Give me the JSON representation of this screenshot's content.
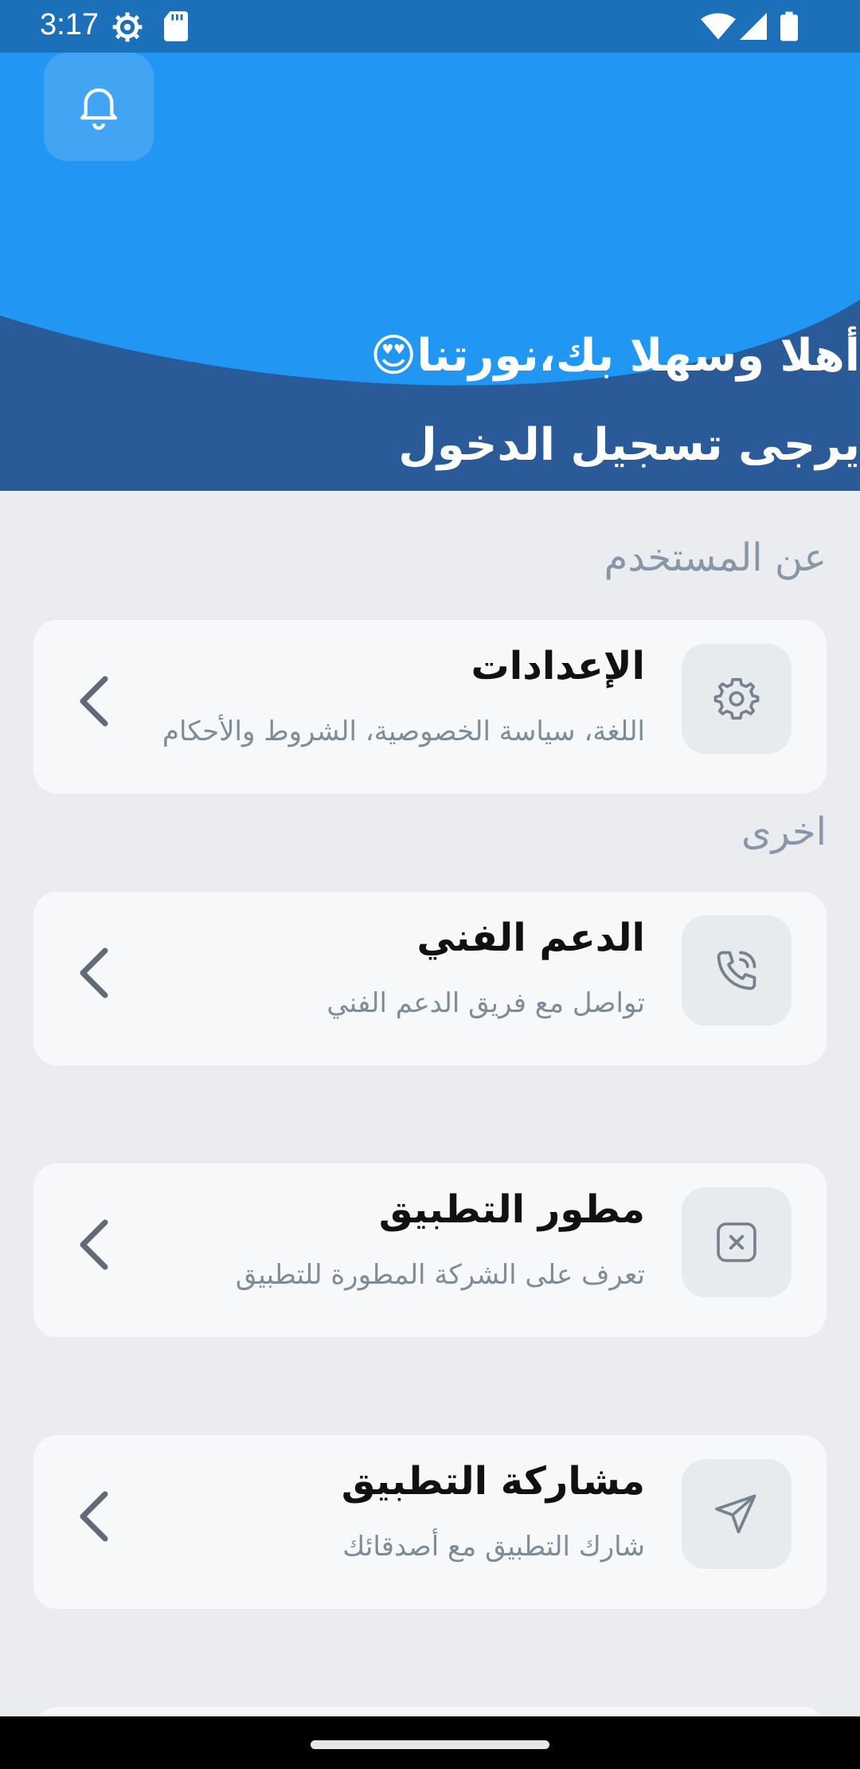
{
  "status_bar": {
    "time": "3:17",
    "icons": [
      "settings-gear-icon",
      "sd-card-icon",
      "wifi-icon",
      "signal-icon",
      "battery-icon"
    ]
  },
  "header": {
    "greeting": "أهلا وسهلا بك،نورتنا😍",
    "login_prompt": "يرجى تسجيل الدخول",
    "bell_icon": "bell-icon",
    "colors": {
      "top": "#2196f3",
      "bottom": "#2a5b98"
    }
  },
  "sections": {
    "user": {
      "title": "عن المستخدم"
    },
    "other": {
      "title": "اخرى"
    }
  },
  "cards": [
    {
      "title": "الإعدادات",
      "subtitle": "اللغة، سياسة الخصوصية، الشروط والأحكام",
      "icon": "gear-icon"
    },
    {
      "title": "الدعم الفني",
      "subtitle": "تواصل مع فريق الدعم الفني",
      "icon": "phone-icon"
    },
    {
      "title": "مطور التطبيق",
      "subtitle": "تعرف على الشركة المطورة للتطبيق",
      "icon": "close-box-icon"
    },
    {
      "title": "مشاركة التطبيق",
      "subtitle": "شارك التطبيق مع أصدقائك",
      "icon": "send-icon"
    }
  ]
}
